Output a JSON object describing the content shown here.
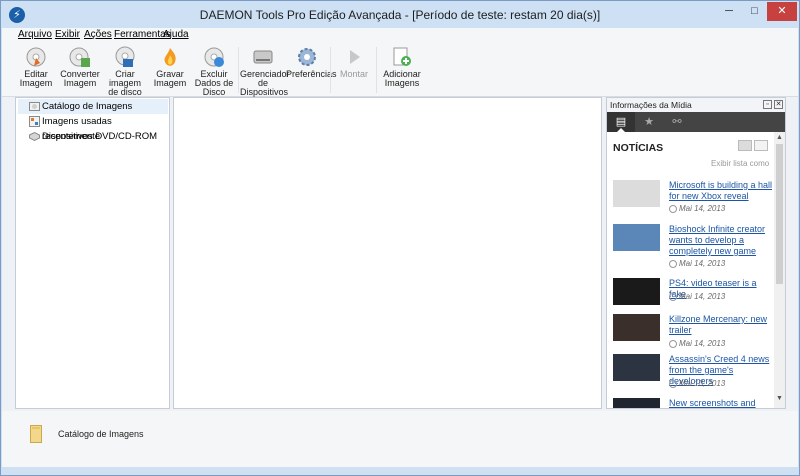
{
  "window": {
    "title": "DAEMON Tools Pro Edição Avançada - [Período de teste: restam 20 dia(s)]",
    "app_icon": "lightning-icon",
    "minimize_glyph": "─",
    "maximize_glyph": "□",
    "close_glyph": "✕"
  },
  "menu": {
    "items": [
      "Arquivo",
      "Exibir",
      "Ações",
      "Ferramentas",
      "Ajuda"
    ]
  },
  "toolbar": {
    "items": [
      {
        "label": "Editar\nImagem",
        "icon": "edit-image-icon",
        "enabled": true
      },
      {
        "label": "Converter\nImagem",
        "icon": "convert-image-icon",
        "enabled": true
      },
      {
        "label": "Criar imagem\nde disco",
        "icon": "create-image-icon",
        "enabled": true
      },
      {
        "label": "Gravar\nImagem",
        "icon": "burn-image-icon",
        "enabled": true
      },
      {
        "label": "Excluir\nDados de\nDisco",
        "icon": "erase-disc-icon",
        "enabled": true
      },
      {
        "label": "Gerenciador\nde\nDispositivos\nVirtuais",
        "icon": "virtual-device-manager-icon",
        "enabled": true
      },
      {
        "label": "Preferências",
        "icon": "gear-icon",
        "enabled": true
      },
      {
        "label": "Montar",
        "icon": "mount-play-icon",
        "enabled": false
      },
      {
        "label": "Adicionar\nImagens",
        "icon": "add-images-icon",
        "enabled": true
      }
    ]
  },
  "tree": {
    "items": [
      {
        "label": "Catálogo de Imagens",
        "icon": "image-catalog-icon",
        "selected": true
      },
      {
        "label": "Imagens usadas recentemente",
        "icon": "recent-images-icon",
        "selected": false
      },
      {
        "label": "Dispositivos DVD/CD-ROM",
        "icon": "dvd-drive-icon",
        "selected": false
      }
    ]
  },
  "media_panel": {
    "title": "Informações da Mídia",
    "restore_glyph": "▫",
    "close_glyph": "✕",
    "tabs": [
      {
        "icon": "document-icon",
        "glyph": "▤",
        "active": true
      },
      {
        "icon": "star-icon",
        "glyph": "★",
        "active": false
      },
      {
        "icon": "link-icon",
        "glyph": "⚯",
        "active": false
      }
    ],
    "news_heading": "NOTÍCIAS",
    "view_hint": "Exibir lista como",
    "news": [
      {
        "title": "Microsoft is building a hall for new Xbox reveal",
        "date": "Mai 14, 2013",
        "thumb_color": "#dcdcdc"
      },
      {
        "title": "Bioshock Infinite creator wants to develop a completely new game",
        "date": "Mai 14, 2013",
        "thumb_color": "#5b86b8"
      },
      {
        "title": "PS4: video teaser is a fake",
        "date": "Mai 14, 2013",
        "thumb_color": "#1a1a1a"
      },
      {
        "title": "Killzone Mercenary: new trailer",
        "date": "Mai 14, 2013",
        "thumb_color": "#3a2f2a"
      },
      {
        "title": "Assassin's Creed 4 news from the game's developers",
        "date": "Mai 13, 2013",
        "thumb_color": "#2b3440"
      },
      {
        "title": "New screenshots and",
        "date": "",
        "thumb_color": "#1f2630"
      }
    ]
  },
  "status": {
    "label": "Catálogo de Imagens",
    "icon": "folder-icon"
  },
  "colors": {
    "link": "#1c55a5",
    "close_button": "#c7413f",
    "panel_tabs": "#444444"
  }
}
